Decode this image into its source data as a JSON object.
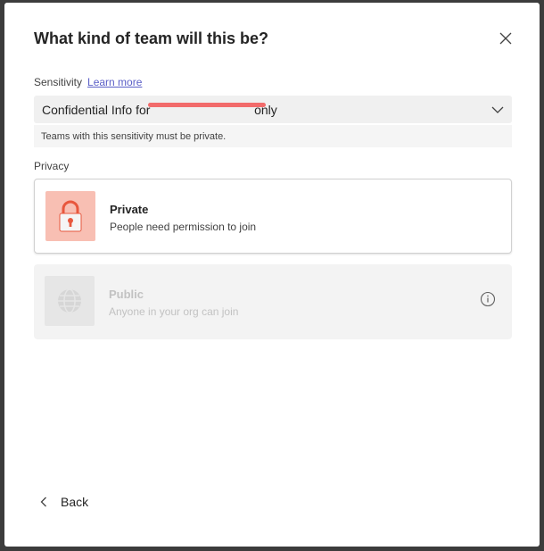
{
  "dialog": {
    "title": "What kind of team will this be?",
    "close_icon": "close-icon"
  },
  "sensitivity": {
    "label": "Sensitivity",
    "learn_more": "Learn more",
    "selected_value": "Confidential Info for                              only",
    "redacted": true,
    "note": "Teams with this sensitivity must be private."
  },
  "privacy": {
    "label": "Privacy",
    "options": [
      {
        "title": "Private",
        "description": "People need permission to join",
        "icon": "lock-icon",
        "selected": true,
        "enabled": true
      },
      {
        "title": "Public",
        "description": "Anyone in your org can join",
        "icon": "globe-icon",
        "selected": false,
        "enabled": false,
        "info_icon": "info-icon"
      }
    ]
  },
  "footer": {
    "back_label": "Back"
  },
  "colors": {
    "accent_link": "#5b5fc7",
    "private_icon_bg": "#f8bfb3",
    "lock_color": "#e8573d",
    "redaction": "#f26b6b"
  }
}
